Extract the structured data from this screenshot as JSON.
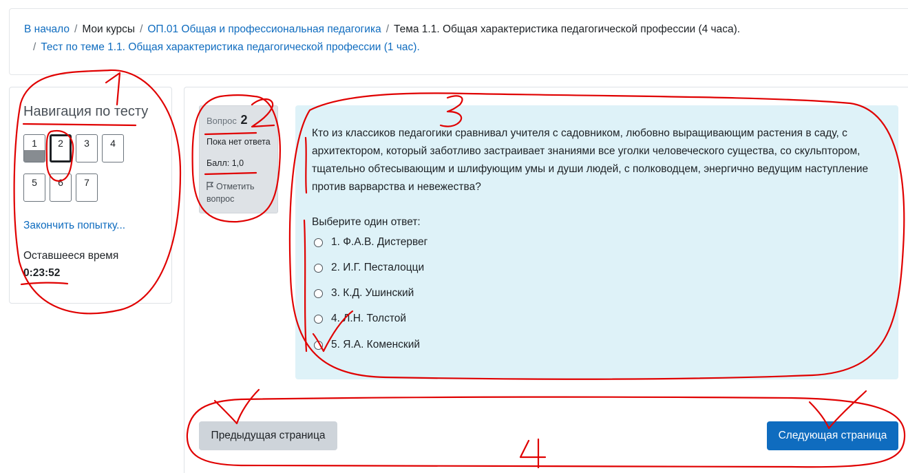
{
  "breadcrumb": {
    "home": "В начало",
    "my_courses": "Мои курсы",
    "course": "ОП.01 Общая и профессиональная педагогика",
    "topic": "Тема 1.1. Общая характеристика педагогической профессии (4 часа).",
    "quiz": "Тест по теме 1.1. Общая характеристика педагогической профессии (1 час)."
  },
  "quiz_nav": {
    "title": "Навигация по тесту",
    "questions": [
      {
        "number": "1",
        "state": "answered"
      },
      {
        "number": "2",
        "state": "current"
      },
      {
        "number": "3",
        "state": "not-answered"
      },
      {
        "number": "4",
        "state": "not-answered"
      },
      {
        "number": "5",
        "state": "not-answered"
      },
      {
        "number": "6",
        "state": "not-answered"
      },
      {
        "number": "7",
        "state": "not-answered"
      }
    ],
    "finish_label": "Закончить попытку...",
    "time_label": "Оставшееся время",
    "time_value": "0:23:52"
  },
  "question_info": {
    "label": "Вопрос",
    "number": "2",
    "state": "Пока нет ответа",
    "grade": "Балл: 1,0",
    "flag_label": "Отметить вопрос",
    "flag_icon": "flag-icon"
  },
  "question": {
    "text": "Кто из классиков педагогики сравнивал учителя с садовником, любовно выращивающим растения в саду, с архитектором, который заботливо застраивает знаниями все уголки человеческого существа, со скульптором, тщательно обтесывающим и шлифующим умы и души людей, с полководцем, энергично ведущим наступление против варварства и невежества?",
    "prompt": "Выберите один ответ:",
    "answers": [
      "1. Ф.А.В. Дистервег",
      "2. И.Г. Песталоцци",
      "3. К.Д. Ушинский",
      "4. Л.Н. Толстой",
      "5. Я.А. Коменский"
    ]
  },
  "navigation": {
    "prev_label": "Предыдущая страница",
    "next_label": "Следующая страница"
  },
  "annotations": {
    "color": "#e00000",
    "labels": [
      "1",
      "2",
      "3",
      "4"
    ]
  },
  "colors": {
    "link": "#0f6cbf",
    "question_bg": "#def2f8",
    "info_bg": "#dee2e6",
    "primary_button": "#0f6cbf",
    "secondary_button": "#ced4da"
  }
}
